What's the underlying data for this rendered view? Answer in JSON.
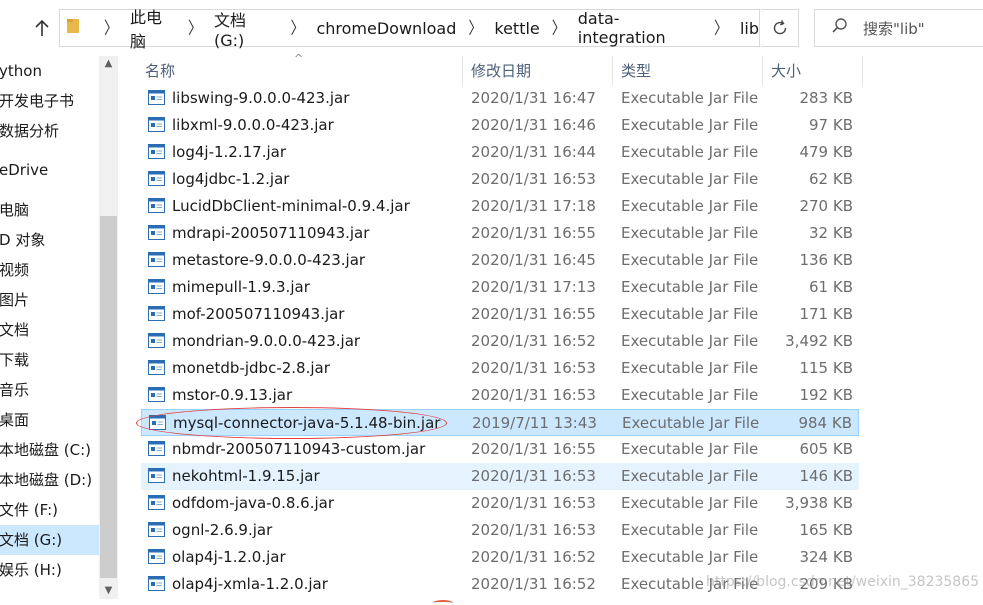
{
  "address": {
    "breadcrumbs": [
      "此电脑",
      "文档 (G:)",
      "chromeDownload",
      "kettle",
      "data-integration",
      "lib"
    ]
  },
  "search": {
    "placeholder": "搜索\"lib\""
  },
  "nav": {
    "items": [
      {
        "label": "ython"
      },
      {
        "label": "开发电子书"
      },
      {
        "label": "数据分析"
      },
      {
        "label": "eDrive"
      },
      {
        "label": "电脑"
      },
      {
        "label": "D 对象"
      },
      {
        "label": "视频"
      },
      {
        "label": "图片"
      },
      {
        "label": "文档"
      },
      {
        "label": "下载"
      },
      {
        "label": "音乐"
      },
      {
        "label": "桌面"
      },
      {
        "label": "本地磁盘 (C:)"
      },
      {
        "label": "本地磁盘 (D:)"
      },
      {
        "label": "文件 (F:)"
      },
      {
        "label": "文档 (G:)"
      },
      {
        "label": "娱乐 (H:)"
      }
    ]
  },
  "columns": {
    "name": "名称",
    "date": "修改日期",
    "type": "类型",
    "size": "大小"
  },
  "files": [
    {
      "name": "libswing-9.0.0.0-423.jar",
      "date": "2020/1/31 16:47",
      "type": "Executable Jar File",
      "size": "283 KB"
    },
    {
      "name": "libxml-9.0.0.0-423.jar",
      "date": "2020/1/31 16:46",
      "type": "Executable Jar File",
      "size": "97 KB"
    },
    {
      "name": "log4j-1.2.17.jar",
      "date": "2020/1/31 16:44",
      "type": "Executable Jar File",
      "size": "479 KB"
    },
    {
      "name": "log4jdbc-1.2.jar",
      "date": "2020/1/31 16:53",
      "type": "Executable Jar File",
      "size": "62 KB"
    },
    {
      "name": "LucidDbClient-minimal-0.9.4.jar",
      "date": "2020/1/31 17:18",
      "type": "Executable Jar File",
      "size": "270 KB"
    },
    {
      "name": "mdrapi-200507110943.jar",
      "date": "2020/1/31 16:55",
      "type": "Executable Jar File",
      "size": "32 KB"
    },
    {
      "name": "metastore-9.0.0.0-423.jar",
      "date": "2020/1/31 16:45",
      "type": "Executable Jar File",
      "size": "136 KB"
    },
    {
      "name": "mimepull-1.9.3.jar",
      "date": "2020/1/31 17:13",
      "type": "Executable Jar File",
      "size": "61 KB"
    },
    {
      "name": "mof-200507110943.jar",
      "date": "2020/1/31 16:55",
      "type": "Executable Jar File",
      "size": "171 KB"
    },
    {
      "name": "mondrian-9.0.0.0-423.jar",
      "date": "2020/1/31 16:52",
      "type": "Executable Jar File",
      "size": "3,492 KB"
    },
    {
      "name": "monetdb-jdbc-2.8.jar",
      "date": "2020/1/31 16:53",
      "type": "Executable Jar File",
      "size": "115 KB"
    },
    {
      "name": "mstor-0.9.13.jar",
      "date": "2020/1/31 16:53",
      "type": "Executable Jar File",
      "size": "192 KB"
    },
    {
      "name": "mysql-connector-java-5.1.48-bin.jar",
      "date": "2019/7/11 13:43",
      "type": "Executable Jar File",
      "size": "984 KB"
    },
    {
      "name": "nbmdr-200507110943-custom.jar",
      "date": "2020/1/31 16:55",
      "type": "Executable Jar File",
      "size": "605 KB"
    },
    {
      "name": "nekohtml-1.9.15.jar",
      "date": "2020/1/31 16:53",
      "type": "Executable Jar File",
      "size": "146 KB"
    },
    {
      "name": "odfdom-java-0.8.6.jar",
      "date": "2020/1/31 16:53",
      "type": "Executable Jar File",
      "size": "3,938 KB"
    },
    {
      "name": "ognl-2.6.9.jar",
      "date": "2020/1/31 16:53",
      "type": "Executable Jar File",
      "size": "165 KB"
    },
    {
      "name": "olap4j-1.2.0.jar",
      "date": "2020/1/31 16:52",
      "type": "Executable Jar File",
      "size": "324 KB"
    },
    {
      "name": "olap4j-xmla-1.2.0.jar",
      "date": "2020/1/31 16:52",
      "type": "Executable Jar File",
      "size": "209 KB"
    }
  ],
  "selected_nav": "文档 (G:)",
  "selected_file": "mysql-connector-java-5.1.48-bin.jar",
  "hover_file": "nekohtml-1.9.15.jar",
  "watermark": "https://blog.csdn.net/weixin_38235865",
  "colors": {
    "selection": "#cce8ff",
    "hover": "#e5f3ff",
    "annotation": "#e04040",
    "header_text": "#4c607a"
  }
}
